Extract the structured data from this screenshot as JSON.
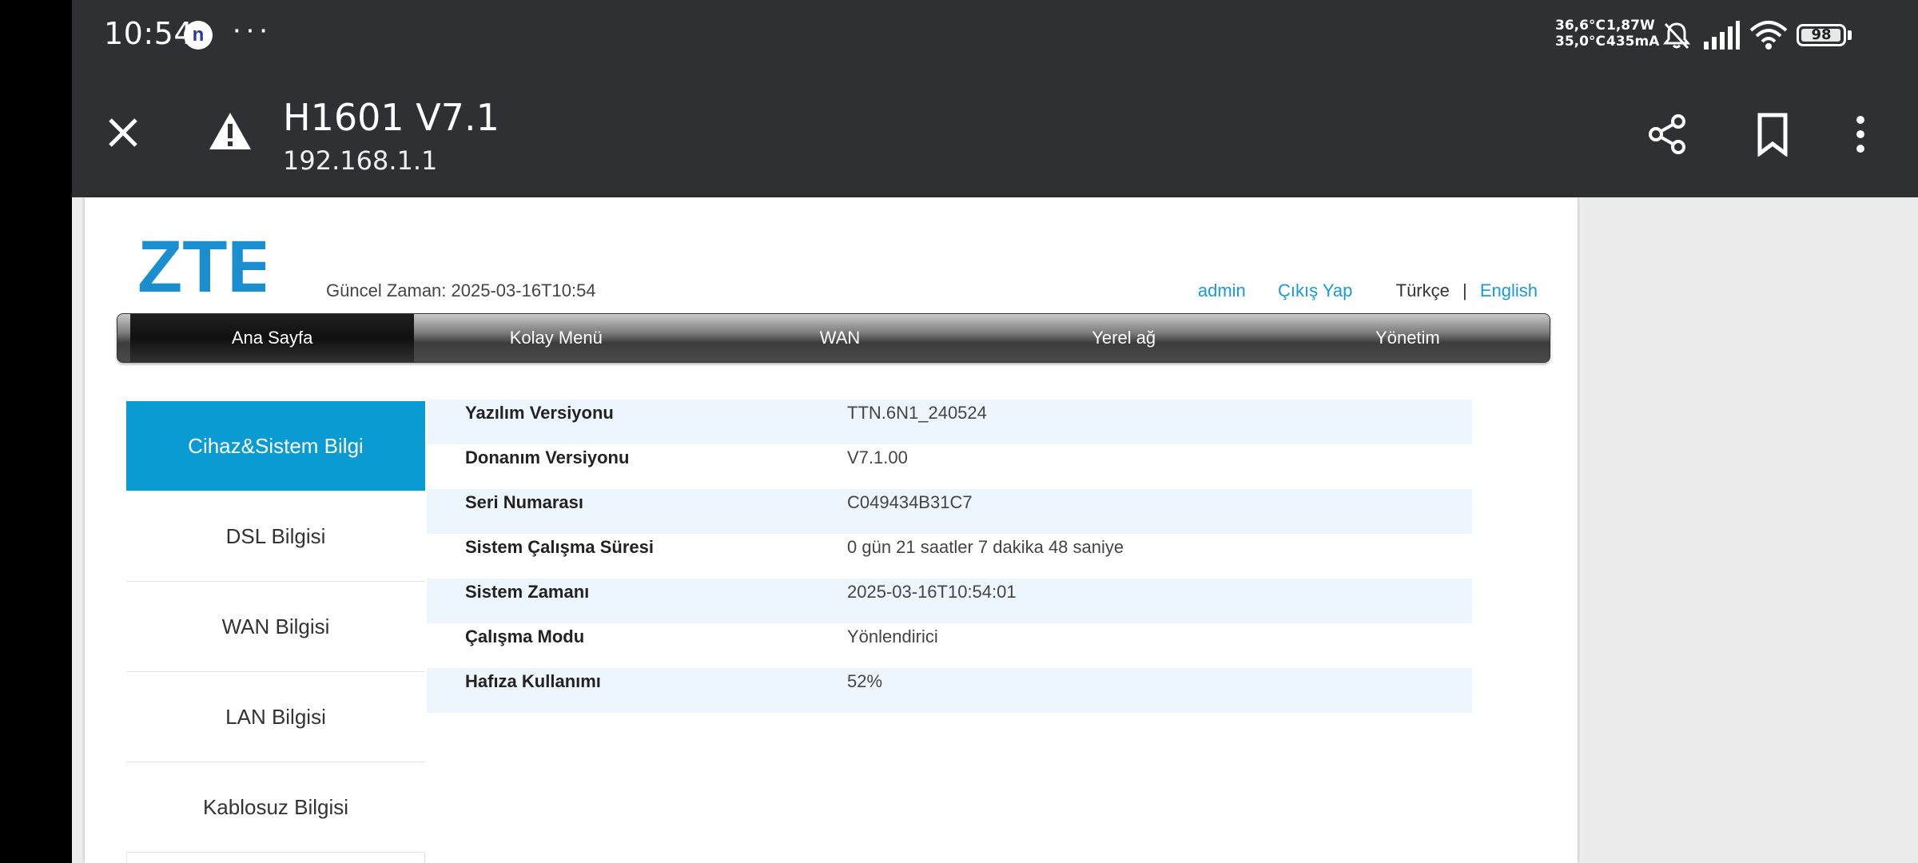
{
  "status_bar": {
    "time": "10:54",
    "notification_badge": "n",
    "more_dots": "···",
    "temp_1": "36,6°C",
    "temp_2": "35,0°C",
    "power": "1,87W",
    "current": "435mA",
    "battery_level": "98",
    "icons": [
      "bell-muted-icon",
      "signal-icon",
      "wifi-icon",
      "battery-icon"
    ]
  },
  "browser": {
    "title": "H1601 V7.1",
    "url": "192.168.1.1",
    "icons": [
      "close-icon",
      "warning-icon",
      "share-icon",
      "bookmark-icon",
      "more-vert-icon"
    ]
  },
  "router": {
    "brand": "ZTE",
    "brand_color": "#1a8ecf",
    "current_time_label": "Güncel Zaman: 2025-03-16T10:54",
    "user": "admin",
    "logout": "Çıkış Yap",
    "lang_tr": "Türkçe",
    "lang_sep": "|",
    "lang_en": "English",
    "nav": [
      "Ana Sayfa",
      "Kolay Menü",
      "WAN",
      "Yerel ağ",
      "Yönetim"
    ],
    "sidebar": [
      "Cihaz&Sistem Bilgi",
      "DSL Bilgisi",
      "WAN Bilgisi",
      "LAN Bilgisi",
      "Kablosuz Bilgisi"
    ],
    "info": [
      {
        "key": "Yazılım Versiyonu",
        "value": "TTN.6N1_240524"
      },
      {
        "key": "Donanım Versiyonu",
        "value": "V7.1.00"
      },
      {
        "key": "Seri Numarası",
        "value": "C049434B31C7"
      },
      {
        "key": "Sistem Çalışma Süresi",
        "value": "0 gün 21 saatler 7 dakika 48 saniye"
      },
      {
        "key": "Sistem Zamanı",
        "value": "2025-03-16T10:54:01"
      },
      {
        "key": "Çalışma Modu",
        "value": "Yönlendirici"
      },
      {
        "key": "Hafıza Kullanımı",
        "value": "52%"
      }
    ],
    "accent_color": "#0a9bd3"
  }
}
